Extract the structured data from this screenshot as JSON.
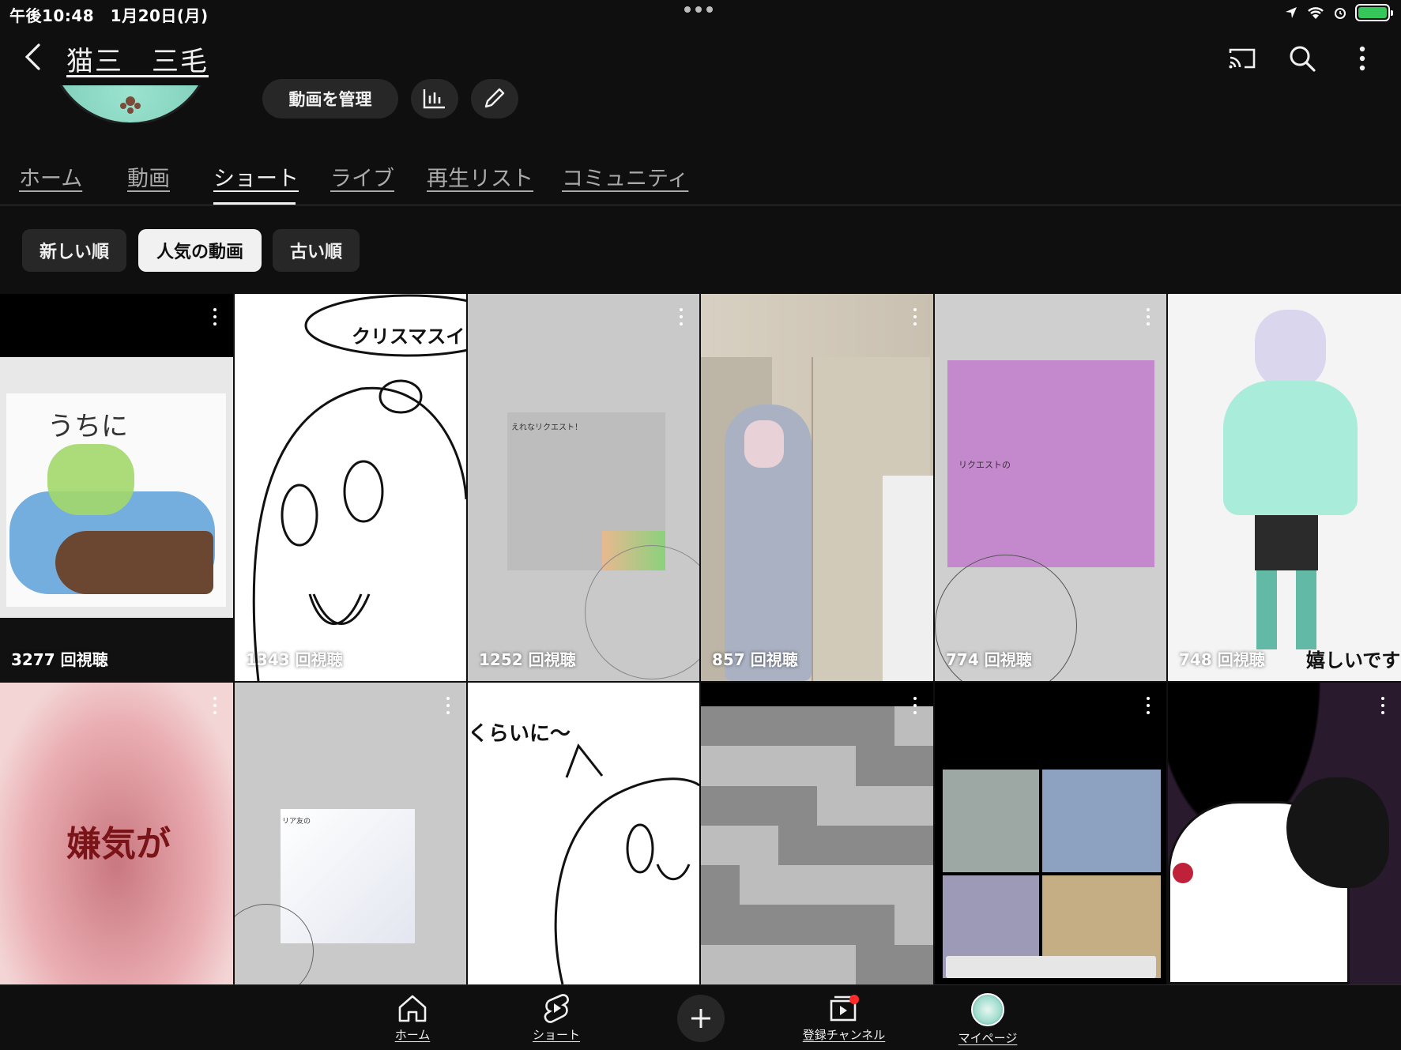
{
  "status": {
    "time": "午後10:48　1月20日(月)",
    "battery_color": "#35c759"
  },
  "header": {
    "channel_name": "猫三　三毛",
    "icons": [
      "back-icon",
      "cast-icon",
      "search-icon",
      "more-vert-icon"
    ]
  },
  "profile": {
    "manage_videos_label": "動画を管理",
    "icons": [
      "analytics-icon",
      "edit-icon"
    ]
  },
  "tabs": [
    {
      "label": "ホーム",
      "active": false
    },
    {
      "label": "動画",
      "active": false
    },
    {
      "label": "ショート",
      "active": true
    },
    {
      "label": "ライブ",
      "active": false
    },
    {
      "label": "再生リスト",
      "active": false
    },
    {
      "label": "コミュニティ",
      "active": false
    }
  ],
  "sort_chips": [
    {
      "label": "新しい順",
      "selected": false
    },
    {
      "label": "人気の動画",
      "selected": true
    },
    {
      "label": "古い順",
      "selected": false
    }
  ],
  "shorts": [
    {
      "views": "3277 回視聴",
      "overlay": "うちに"
    },
    {
      "views": "1343 回視聴",
      "overlay": "クリスマスイ"
    },
    {
      "views": "1252 回視聴",
      "overlay": "えれなリクエスト！"
    },
    {
      "views": "857 回視聴",
      "overlay": ""
    },
    {
      "views": "774 回視聴",
      "overlay": "リクエストの"
    },
    {
      "views": "748 回視聴",
      "overlay": "嬉しいです"
    },
    {
      "views": "",
      "overlay": "嫌気が"
    },
    {
      "views": "",
      "overlay": "リア友の"
    },
    {
      "views": "",
      "overlay": "くらいに〜"
    },
    {
      "views": "",
      "overlay": ""
    },
    {
      "views": "",
      "overlay": ""
    },
    {
      "views": "",
      "overlay": ""
    }
  ],
  "bottom_nav": [
    {
      "label": "ホーム",
      "icon": "home-icon"
    },
    {
      "label": "ショート",
      "icon": "shorts-icon"
    },
    {
      "label": "",
      "icon": "create-icon"
    },
    {
      "label": "登録チャンネル",
      "icon": "subscriptions-icon"
    },
    {
      "label": "マイページ",
      "icon": "avatar"
    }
  ]
}
